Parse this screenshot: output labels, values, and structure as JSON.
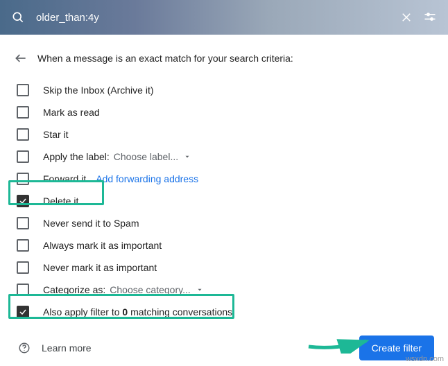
{
  "search": {
    "query": "older_than:4y"
  },
  "header": {
    "text": "When a message is an exact match for your search criteria:"
  },
  "options": {
    "skip_inbox": {
      "label": "Skip the Inbox (Archive it)",
      "checked": false
    },
    "mark_read": {
      "label": "Mark as read",
      "checked": false
    },
    "star_it": {
      "label": "Star it",
      "checked": false
    },
    "apply_label": {
      "label": "Apply the label:",
      "dropdown": "Choose label...",
      "checked": false
    },
    "forward_it": {
      "label": "Forward it",
      "link": "Add forwarding address",
      "checked": false
    },
    "delete_it": {
      "label": "Delete it",
      "checked": true
    },
    "never_spam": {
      "label": "Never send it to Spam",
      "checked": false
    },
    "always_important": {
      "label": "Always mark it as important",
      "checked": false
    },
    "never_important": {
      "label": "Never mark it as important",
      "checked": false
    },
    "categorize": {
      "label": "Categorize as:",
      "dropdown": "Choose category...",
      "checked": false
    },
    "also_apply": {
      "prefix": "Also apply filter to ",
      "count": "0",
      "suffix": " matching conversations.",
      "checked": true
    }
  },
  "footer": {
    "learn_more": "Learn more",
    "create": "Create filter"
  },
  "watermark": "wsxdn.com"
}
